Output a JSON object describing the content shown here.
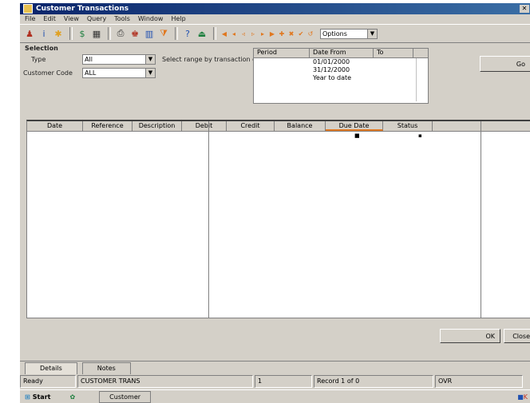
{
  "window": {
    "title": "Customer Transactions"
  },
  "menu": [
    "File",
    "Edit",
    "View",
    "Query",
    "Tools",
    "Window",
    "Help"
  ],
  "toolbar": {
    "nav_count": 10,
    "search_combo_value": "Options"
  },
  "filters": {
    "section_label": "Selection",
    "field1_label": "Type",
    "field1_value": "All",
    "field2_label": "Customer Code",
    "field2_value": "ALL",
    "range_label": "Select range by transaction date",
    "go_label": "Go"
  },
  "lookup": {
    "columns": [
      "Period",
      "Date From",
      "To"
    ],
    "rows": [
      {
        "a": "",
        "b": "01/01/2000",
        "c": ""
      },
      {
        "a": "",
        "b": "31/12/2000",
        "c": ""
      },
      {
        "a": "",
        "b": "Year to date",
        "c": ""
      }
    ]
  },
  "grid": {
    "columns": [
      "Date",
      "Reference",
      "Description",
      "Debit",
      "Credit",
      "Balance",
      "Due Date",
      "Status"
    ],
    "active_column": 6
  },
  "buttons": {
    "ok": "OK",
    "cancel": "Close"
  },
  "tabs": [
    "Details",
    "Notes"
  ],
  "status": [
    "Ready",
    "CUSTOMER TRANS",
    "1",
    "Record 1 of 0",
    "OVR"
  ],
  "taskbar": {
    "start": "Start",
    "task": "Customer"
  }
}
